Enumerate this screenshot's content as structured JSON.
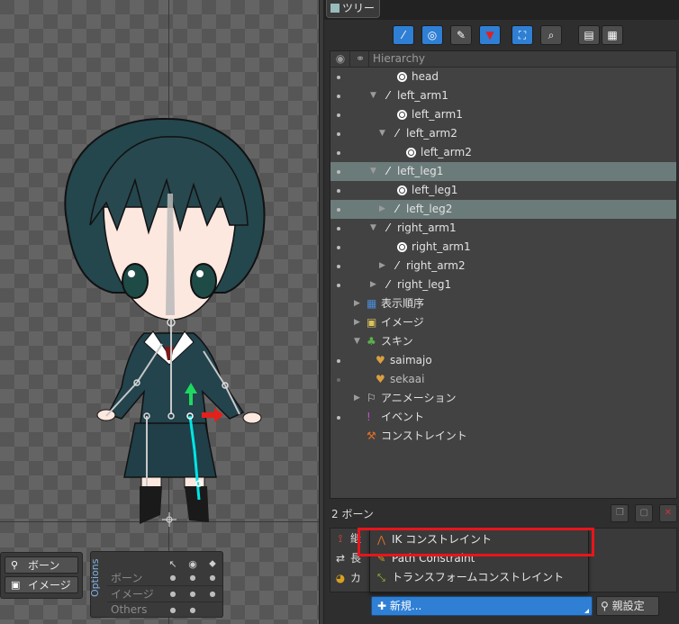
{
  "panel": {
    "tab_label": "ツリー",
    "hierarchy_label": "Hierarchy"
  },
  "tree": {
    "rows": [
      {
        "label": "head",
        "kind": "slot",
        "visible": true
      },
      {
        "label": "left_arm1",
        "kind": "bone",
        "visible": true,
        "expanded": true
      },
      {
        "label": "left_arm1",
        "kind": "slot",
        "visible": true
      },
      {
        "label": "left_arm2",
        "kind": "bone",
        "visible": true,
        "expanded": true
      },
      {
        "label": "left_arm2",
        "kind": "slot",
        "visible": true
      },
      {
        "label": "left_leg1",
        "kind": "bone",
        "visible": true,
        "expanded": true,
        "selected": true
      },
      {
        "label": "left_leg1",
        "kind": "slot",
        "visible": true
      },
      {
        "label": "left_leg2",
        "kind": "bone",
        "visible": true,
        "expanded": false,
        "selected": true
      },
      {
        "label": "right_arm1",
        "kind": "bone",
        "visible": true,
        "expanded": true
      },
      {
        "label": "right_arm1",
        "kind": "slot",
        "visible": true
      },
      {
        "label": "right_arm2",
        "kind": "bone",
        "visible": true,
        "expanded": false
      },
      {
        "label": "right_leg1",
        "kind": "bone",
        "visible": true,
        "expanded": false
      },
      {
        "label": "表示順序",
        "kind": "draworder",
        "expanded": false
      },
      {
        "label": "イメージ",
        "kind": "images",
        "expanded": false
      },
      {
        "label": "スキン",
        "kind": "skins",
        "expanded": true
      },
      {
        "label": "saimajo",
        "kind": "skin",
        "visible": true
      },
      {
        "label": "sekaai",
        "kind": "skin",
        "visible": false
      },
      {
        "label": "アニメーション",
        "kind": "animations",
        "expanded": false
      },
      {
        "label": "イベント",
        "kind": "events",
        "visible": true
      },
      {
        "label": "コンストレイント",
        "kind": "constraints"
      }
    ]
  },
  "bottom": {
    "bone_count": "2 ボーン",
    "prop_rows": [
      {
        "icon": "ç",
        "label": "継"
      },
      {
        "icon": "⇄",
        "label": "長"
      },
      {
        "icon": "◐",
        "label": "カ"
      }
    ],
    "new_label": "新規...",
    "parent_label": "親設定"
  },
  "menu": {
    "items": [
      {
        "icon": "ik-icon",
        "label": "IK コンストレイント"
      },
      {
        "icon": "path-icon",
        "label": "Path Constraint"
      },
      {
        "icon": "transform-icon",
        "label": "トランスフォームコンストレイント"
      }
    ]
  },
  "modes": {
    "bone_label": "ボーン",
    "image_label": "イメージ"
  },
  "options": {
    "label": "Options",
    "rows": [
      "ボーン",
      "イメージ",
      "Others"
    ]
  },
  "colors": {
    "accent": "#2f7fd4",
    "selection": "#6b7b7a",
    "highlight": "#e8151b"
  }
}
